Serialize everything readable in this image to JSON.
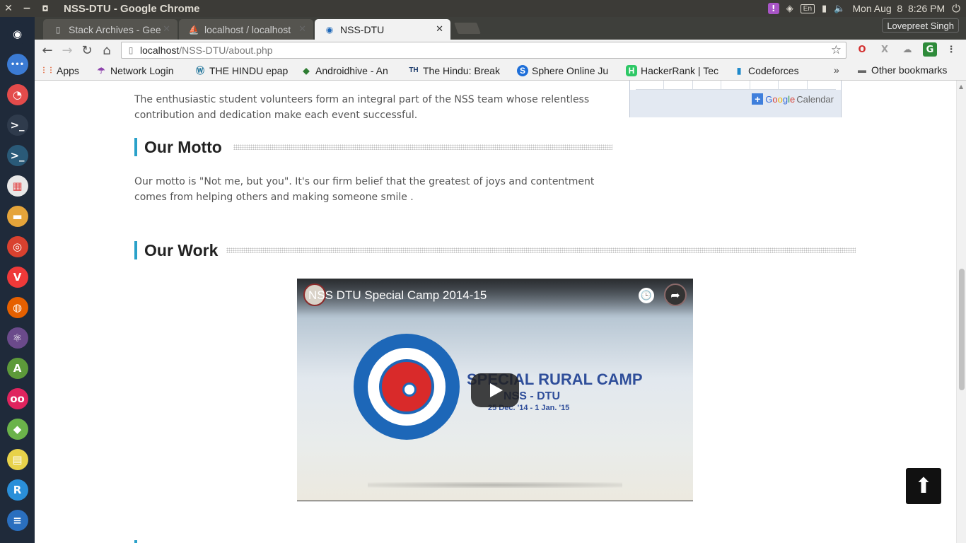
{
  "os_panel": {
    "window_title": "NSS-DTU - Google Chrome",
    "close_glyph": "✕",
    "minimize_glyph": "−",
    "maximize_glyph": "◘",
    "keyboard_layout": "En",
    "datetime": "Mon Aug  8  8:26 PM",
    "alert_glyph": "!",
    "wifi_glyph": "◈",
    "battery_glyph": "▮",
    "volume_glyph": "🔈",
    "power_glyph": "⏻"
  },
  "browser": {
    "tabs": [
      {
        "label": "Stack Archives - Geeks",
        "icon": "page-icon",
        "glyph": "▯",
        "close": "✕"
      },
      {
        "label": "localhost / localhost",
        "icon": "phpmyadmin-icon",
        "glyph": "⛵",
        "close": "✕"
      },
      {
        "label": "NSS-DTU",
        "icon": "nss-logo-icon",
        "glyph": "◉",
        "close": "✕"
      }
    ],
    "profile_name": "Lovepreet Singh",
    "url_host": "localhost",
    "url_path": "/NSS-DTU/about.php",
    "nav": {
      "back": "←",
      "forward": "→",
      "reload": "↻",
      "home": "⌂",
      "page": "▯",
      "star": "☆"
    },
    "extensions": [
      {
        "name": "opera-icon",
        "glyph": "O",
        "color": "#d32f2f"
      },
      {
        "name": "x-icon",
        "glyph": "X",
        "color": "#9e9e9e"
      },
      {
        "name": "cloud-icon",
        "glyph": "☁",
        "color": "#8a8a8a"
      },
      {
        "name": "g-icon",
        "glyph": "G",
        "color": "#2e8b3a"
      },
      {
        "name": "menu-icon",
        "glyph": "⋮",
        "color": "#555555"
      }
    ],
    "bookmarks": [
      {
        "label": "Apps",
        "icon": "apps-icon",
        "glyph": "⋮⋮",
        "color": "#e05a2b",
        "width": 62
      },
      {
        "label": "Network Login",
        "icon": "umbrella-icon",
        "glyph": "☂",
        "color": "#8e44ad",
        "width": 126
      },
      {
        "label": "THE HINDU epap",
        "icon": "wordpress-icon",
        "glyph": "Ⓦ",
        "color": "#21759b",
        "width": 136
      },
      {
        "label": "Androidhive - An",
        "icon": "androidhive-icon",
        "glyph": "◆",
        "color": "#2e7d32",
        "width": 138
      },
      {
        "label": "The Hindu: Break",
        "icon": "hindu-icon",
        "glyph": "TH",
        "color": "#1a3a6b",
        "width": 140
      },
      {
        "label": "Sphere Online Ju",
        "icon": "spoj-icon",
        "glyph": "S",
        "color": "#1e6fd9",
        "width": 140
      },
      {
        "label": "HackerRank | Tec",
        "icon": "hackerrank-icon",
        "glyph": "H",
        "color": "#2ec866",
        "width": 138
      },
      {
        "label": "Codeforces",
        "icon": "codeforces-icon",
        "glyph": "▮",
        "color": "#1f8acb",
        "width": 108
      }
    ],
    "more_glyph": "»",
    "other_bookmarks": "Other bookmarks",
    "folder_glyph": "▬"
  },
  "launcher": [
    {
      "name": "ubuntu-logo-icon",
      "glyph": "◉",
      "color": "#1f2a3a"
    },
    {
      "name": "files-dots-icon",
      "glyph": "•••",
      "color": "#3b7bd4"
    },
    {
      "name": "disk-icon",
      "glyph": "◔",
      "color": "#e34b4b"
    },
    {
      "name": "terminal-icon",
      "glyph": ">_",
      "color": "#2f3b4c"
    },
    {
      "name": "terminal-alt-icon",
      "glyph": ">_",
      "color": "#2a5a78"
    },
    {
      "name": "software-center-icon",
      "glyph": "▦",
      "color": "#e8e8e8"
    },
    {
      "name": "folder-icon",
      "glyph": "▬",
      "color": "#e5a43a"
    },
    {
      "name": "chrome-icon",
      "glyph": "◎",
      "color": "#d9412f"
    },
    {
      "name": "vivaldi-icon",
      "glyph": "V",
      "color": "#ef3939"
    },
    {
      "name": "firefox-icon",
      "glyph": "◍",
      "color": "#e66000"
    },
    {
      "name": "atom-icon",
      "glyph": "⚛",
      "color": "#6b4a8b"
    },
    {
      "name": "android-studio-icon",
      "glyph": "A",
      "color": "#5d9a3a"
    },
    {
      "name": "flickr-icon",
      "glyph": "oo",
      "color": "#e0245e"
    },
    {
      "name": "app-green-icon",
      "glyph": "◆",
      "color": "#6bb34a"
    },
    {
      "name": "app-yellow-icon",
      "glyph": "▤",
      "color": "#e8d24a"
    },
    {
      "name": "r-app-icon",
      "glyph": "R",
      "color": "#2a8fd9"
    },
    {
      "name": "stack-icon",
      "glyph": "≡",
      "color": "#2a6fbf"
    }
  ],
  "page": {
    "intro_text": "The enthusiastic student volunteers form an integral part of the NSS team whose relentless contribution and dedication make each event successful.",
    "motto_heading": "Our Motto",
    "motto_text": "Our motto is \"Not me, but you\". It's our firm belief that the greatest of joys and contentment comes from helping others and making someone smile .",
    "work_heading": "Our Work",
    "calendar": {
      "plus": "+",
      "google": [
        "G",
        "o",
        "o",
        "g",
        "l",
        "e"
      ],
      "word": "Calendar"
    },
    "video": {
      "title": "NSS DTU Special Camp 2014-15",
      "clock_glyph": "🕒",
      "share_glyph": "➦",
      "camp_title": "SPECIAL RURAL CAMP",
      "camp_sub": "NSS - DTU",
      "camp_dates": "25 Dec. '14 - 1 Jan. '15"
    },
    "back_to_top_glyph": "⬆"
  },
  "colors": {
    "accent": "#2aa1c9",
    "panel": "#3c3b37",
    "launcher": "#1f2a3a"
  }
}
